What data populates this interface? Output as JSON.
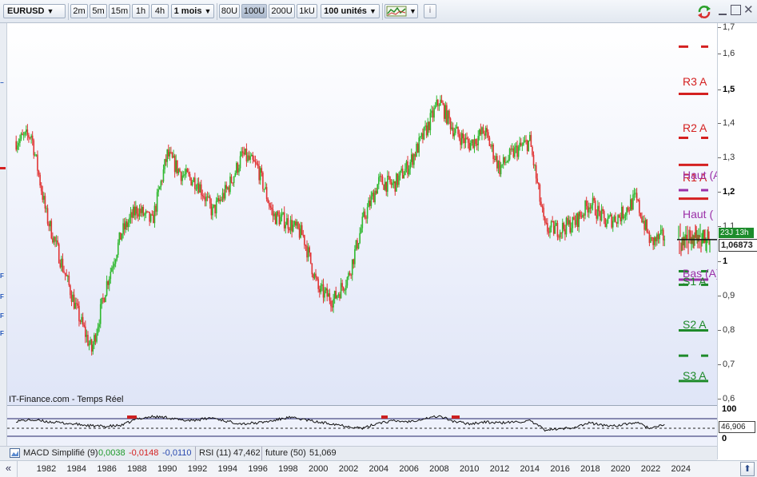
{
  "toolbar": {
    "symbol": "EURUSD",
    "timeframes": [
      "2m",
      "5m",
      "15m",
      "1h",
      "4h"
    ],
    "period": "1 mois",
    "units": [
      "80U",
      "100U",
      "200U",
      "1kU"
    ],
    "active_unit": "100U",
    "units_count": "100 unités",
    "info": "i"
  },
  "chart": {
    "source_label": "IT-Finance.com - Temps Réel",
    "last_price": "1,06873",
    "time_remaining": "23J 13h",
    "price_scale": [
      "1,7",
      "1,6",
      "1,5",
      "1,4",
      "1,3",
      "1,2",
      "1,1",
      "1",
      "0,9",
      "0,8",
      "0,7",
      "0,6"
    ],
    "levels": [
      {
        "label": "R3 A",
        "color": "#d42020"
      },
      {
        "label": "R2 A",
        "color": "#d42020"
      },
      {
        "label": "R1 A",
        "color": "#d42020"
      },
      {
        "label": "Haut (A)",
        "color": "#9b30a8"
      },
      {
        "label": "Haut (",
        "color": "#9b30a8"
      },
      {
        "label": "Bas (A)",
        "color": "#9b30a8"
      },
      {
        "label": "S1 A",
        "color": "#1e8a2a"
      },
      {
        "label": "S2 A",
        "color": "#1e8a2a"
      },
      {
        "label": "S3 A",
        "color": "#1e8a2a"
      }
    ],
    "up_color": "#2fb82f",
    "down_color": "#e03434"
  },
  "chart_data": {
    "type": "candlestick",
    "x": [
      "1980",
      "1981",
      "1982",
      "1983",
      "1984",
      "1985",
      "1986",
      "1987",
      "1988",
      "1989",
      "1990",
      "1991",
      "1992",
      "1993",
      "1994",
      "1995",
      "1996",
      "1997",
      "1998",
      "1999",
      "2000",
      "2001",
      "2002",
      "2003",
      "2004",
      "2005",
      "2006",
      "2007",
      "2008",
      "2009",
      "2010",
      "2011",
      "2012",
      "2013",
      "2014",
      "2015",
      "2016",
      "2017",
      "2018",
      "2019",
      "2020",
      "2021",
      "2022",
      "2023"
    ],
    "y": [
      1.36,
      1.38,
      1.14,
      1.0,
      0.86,
      0.74,
      0.94,
      1.09,
      1.16,
      1.12,
      1.32,
      1.26,
      1.24,
      1.15,
      1.22,
      1.32,
      1.28,
      1.14,
      1.12,
      1.08,
      0.92,
      0.89,
      0.96,
      1.13,
      1.24,
      1.23,
      1.29,
      1.38,
      1.48,
      1.39,
      1.35,
      1.39,
      1.28,
      1.33,
      1.36,
      1.1,
      1.1,
      1.12,
      1.18,
      1.12,
      1.14,
      1.19,
      1.06,
      1.08
    ],
    "ylim": [
      0.6,
      1.72
    ],
    "price_ticks": [
      1.7,
      1.6,
      1.5,
      1.4,
      1.3,
      1.2,
      1.1,
      1.0,
      0.9,
      0.8,
      0.7,
      0.6
    ],
    "years": [
      "1982",
      "1984",
      "1986",
      "1988",
      "1990",
      "1992",
      "1994",
      "1996",
      "1998",
      "2000",
      "2002",
      "2004",
      "2006",
      "2008",
      "2010",
      "2012",
      "2014",
      "2016",
      "2018",
      "2020",
      "2022",
      "2024"
    ],
    "pivot_levels": [
      1.64,
      1.5,
      1.37,
      1.29,
      1.215,
      1.19,
      0.975,
      0.95,
      0.935,
      0.8,
      0.725,
      0.65
    ],
    "rsi": {
      "label": "RSI (11)",
      "value": "47,462",
      "series": [
        62,
        66,
        60,
        55,
        50,
        44,
        42,
        46,
        70,
        78,
        75,
        64,
        66,
        74,
        60,
        52,
        55,
        63,
        75,
        68,
        57,
        52,
        42,
        35,
        56,
        62,
        60,
        71,
        80,
        60,
        52,
        58,
        55,
        58,
        62,
        30,
        32,
        40,
        55,
        45,
        46,
        57,
        35,
        48
      ],
      "ticks": [
        "100",
        "0"
      ],
      "tag": "46,906"
    }
  },
  "legend": {
    "macd_label": "MACD Simplifié (9)",
    "macd_v1": "0,0038",
    "macd_v2": "-0,0148",
    "macd_v3": "-0,0110",
    "rsi_label": "RSI (11)",
    "rsi_value": "47,462",
    "future_label": "future (50)",
    "future_value": "51,069"
  }
}
